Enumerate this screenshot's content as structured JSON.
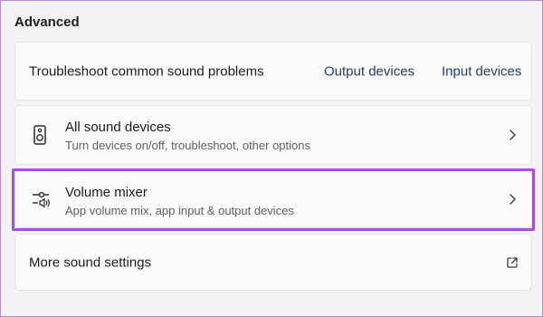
{
  "section": {
    "title": "Advanced"
  },
  "troubleshoot": {
    "label": "Troubleshoot common sound problems",
    "output_link": "Output devices",
    "input_link": "Input devices"
  },
  "all_devices": {
    "title": "All sound devices",
    "subtitle": "Turn devices on/off, troubleshoot, other options",
    "icon": "speaker-icon"
  },
  "volume_mixer": {
    "title": "Volume mixer",
    "subtitle": "App volume mix, app input & output devices",
    "icon": "volume-mixer-icon",
    "highlight_color": "#a64ee0"
  },
  "more_settings": {
    "label": "More sound settings",
    "icon": "external-link-icon"
  },
  "colors": {
    "background": "#f3f3f3",
    "card": "#fbfbfb",
    "link": "#1d3f66"
  }
}
